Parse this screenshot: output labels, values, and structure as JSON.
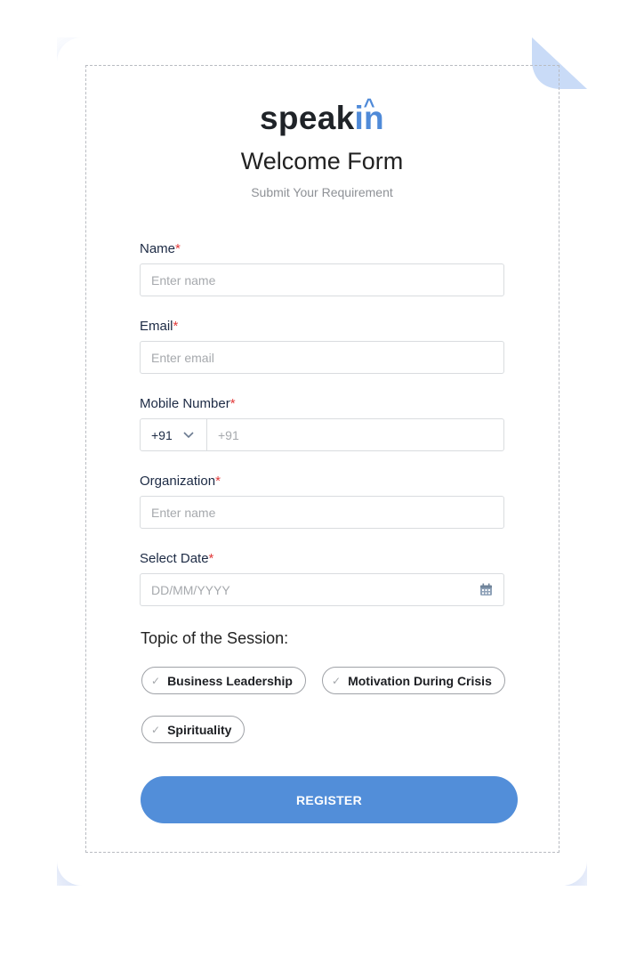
{
  "brand": {
    "logo_prefix": "speak",
    "logo_accent": "in",
    "accent_color": "#4f8ad8"
  },
  "header": {
    "title": "Welcome Form",
    "subtitle": "Submit Your Requirement"
  },
  "form": {
    "required_marker": "*",
    "name": {
      "label": "Name",
      "placeholder": "Enter name"
    },
    "email": {
      "label": "Email",
      "placeholder": "Enter email"
    },
    "mobile": {
      "label": "Mobile Number",
      "country_code": "+91",
      "placeholder": "+91"
    },
    "organization": {
      "label": "Organization",
      "placeholder": "Enter name"
    },
    "date": {
      "label": "Select Date",
      "placeholder": "DD/MM/YYYY"
    },
    "topic": {
      "label": "Topic of the Session:",
      "options": [
        "Business Leadership",
        "Motivation During Crisis",
        "Spirituality"
      ]
    },
    "submit_label": "REGISTER",
    "submit_color": "#528ed9"
  },
  "icons": {
    "chip_check": "check-icon",
    "country_dropdown": "chevron-down-icon",
    "date_picker": "calendar-icon"
  }
}
